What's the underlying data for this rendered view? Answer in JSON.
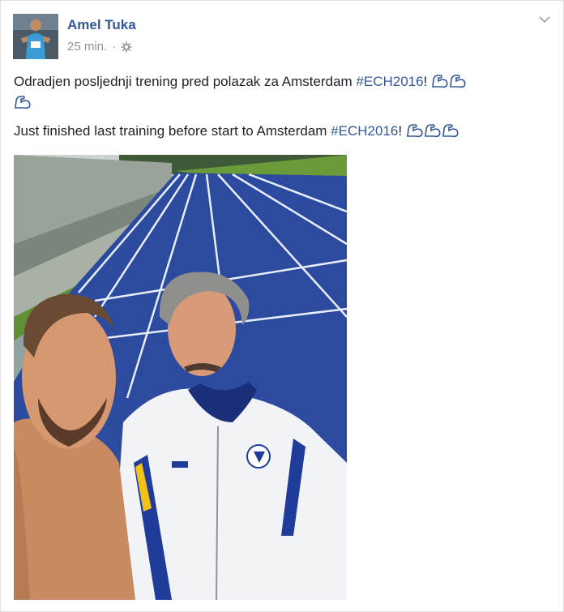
{
  "post": {
    "author": "Amel Tuka",
    "time": "25 min.",
    "separator": "·",
    "privacy_icon": "public-gear-icon",
    "line1_text": "Odradjen posljednji trening pred polazak za Amsterdam ",
    "line1_hashtag": "#ECH2016",
    "line1_suffix": "!",
    "line2_text": "Just finished last training before start to Amsterdam ",
    "line2_hashtag": "#ECH2016",
    "line2_suffix": "!",
    "emoji_icon": "flexed-biceps-icon",
    "line1_emoji_count": 3,
    "line2_emoji_count": 3
  },
  "colors": {
    "link": "#365899",
    "text": "#1d2129",
    "meta": "#90949c",
    "track": "#2c4a9e",
    "grass": "#6a9a3a"
  }
}
